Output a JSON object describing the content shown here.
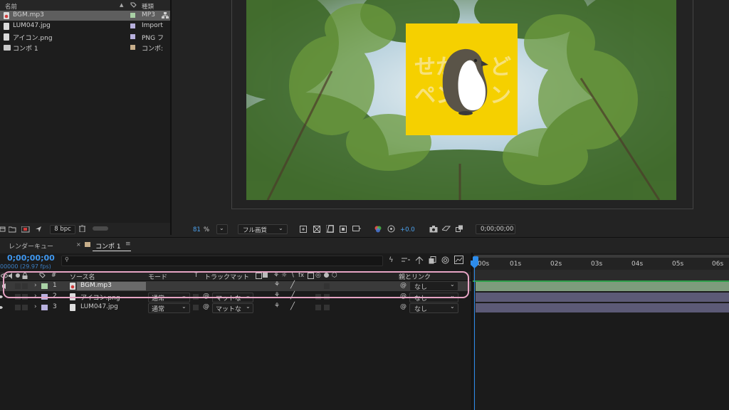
{
  "project": {
    "col_name": "名前",
    "col_type": "種類",
    "items": [
      {
        "name": "BGM.mp3",
        "type": "MP3",
        "label_color": "#a9d1a5"
      },
      {
        "name": "LUM047.jpg",
        "type": "Import",
        "label_color": "#b7b0dd"
      },
      {
        "name": "アイコン.png",
        "type": "PNG フ",
        "label_color": "#b7b0dd"
      },
      {
        "name": "コンポ 1",
        "type": "コンポ:",
        "label_color": "#c7ae8a"
      }
    ],
    "bpc": "8 bpc"
  },
  "viewer": {
    "zoom": "81",
    "zoom_unit": "%",
    "resolution": "フル画質",
    "exposure": "+0.0",
    "timecode": "0;00;00;00",
    "logo_text_top": "せか",
    "logo_text_top2": "ど",
    "logo_text_bottom": "ペン",
    "logo_text_bottom2": "ン"
  },
  "timeline": {
    "tab_render_queue": "レンダーキュー",
    "tab_comp": "コンポ 1",
    "current_time": "0;00;00;00",
    "fps": "00000 (29.97 fps)",
    "search_placeholder": "",
    "col_num": "#",
    "col_source": "ソース名",
    "col_mode": "モード",
    "col_t": "T",
    "col_trackmatte": "トラックマット",
    "col_parent": "親とリンク",
    "layers": [
      {
        "num": "1",
        "name": "BGM.mp3",
        "mode": "",
        "matte": "",
        "parent": "なし",
        "label_color": "#a9d1a5",
        "track_color": "#7d9c7c"
      },
      {
        "num": "2",
        "name": "アイコン.png",
        "mode": "通常",
        "matte": "マットな",
        "parent": "なし",
        "label_color": "#b7b0dd",
        "track_color": "#5c5a76"
      },
      {
        "num": "3",
        "name": "LUM047.jpg",
        "mode": "通常",
        "matte": "マットな",
        "parent": "なし",
        "label_color": "#b7b0dd",
        "track_color": "#5c5a76"
      }
    ],
    "ruler": [
      "0s",
      "01s",
      "02s",
      "03s",
      "04s",
      "05s",
      "06s"
    ],
    "ruler_first_display": ":00s"
  },
  "colors": {
    "accent_blue": "#2d8ceb",
    "highlight_pink": "#e6a4c4",
    "logo_yellow": "#f5d000"
  }
}
